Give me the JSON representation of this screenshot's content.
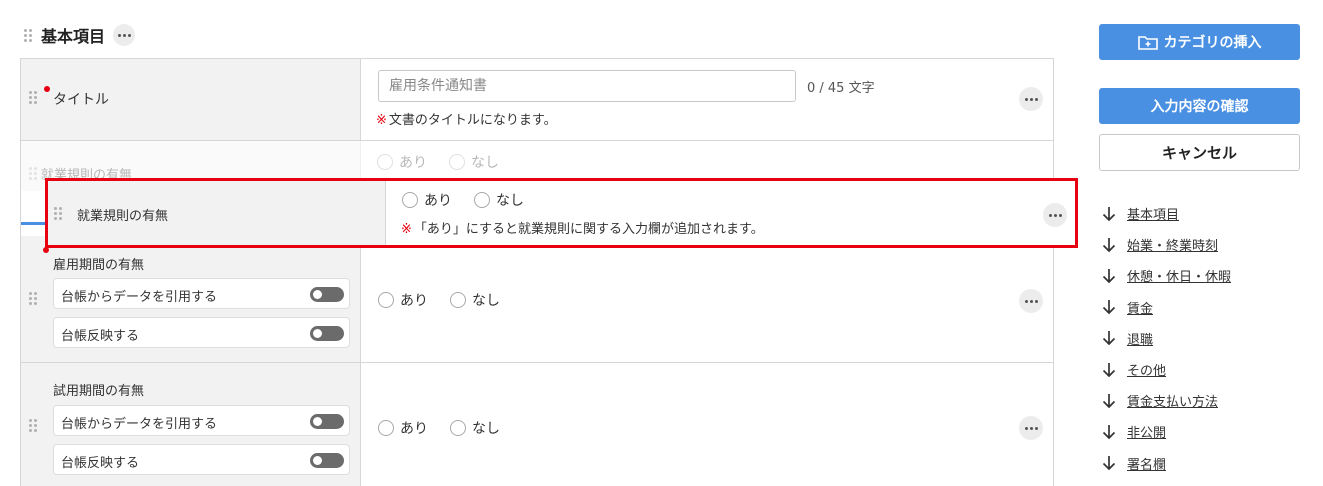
{
  "section": {
    "title": "基本項目"
  },
  "rows": {
    "title": {
      "label": "タイトル",
      "input_placeholder": "雇用条件通知書",
      "input_value": "",
      "counter": "0 / 45 文字",
      "note_mark": "※",
      "note": "文書のタイトルになります。"
    },
    "ghost": {
      "label": "就業規則の有無",
      "opt_yes": "あり",
      "opt_no": "なし"
    },
    "dragging": {
      "label": "就業規則の有無",
      "opt_yes": "あり",
      "opt_no": "なし",
      "note_mark": "※",
      "note": "「あり」にすると就業規則に関する入力欄が追加されます。"
    },
    "employment_period": {
      "label": "雇用期間の有無",
      "toggle_reference": "台帳からデータを引用する",
      "toggle_reflect": "台帳反映する",
      "opt_yes": "あり",
      "opt_no": "なし"
    },
    "trial_period": {
      "label": "試用期間の有無",
      "toggle_reference": "台帳からデータを引用する",
      "toggle_reflect": "台帳反映する",
      "opt_yes": "あり",
      "opt_no": "なし"
    }
  },
  "sidebar": {
    "insert_category_label": "カテゴリの挿入",
    "confirm_label": "入力内容の確認",
    "cancel_label": "キャンセル",
    "toc": [
      "基本項目",
      "始業・終業時刻",
      "休憩・休日・休暇",
      "賃金",
      "退職",
      "その他",
      "賃金支払い方法",
      "非公開",
      "署名欄"
    ]
  },
  "colors": {
    "accent": "#4a90e2",
    "required": "#e60012",
    "highlight": "#e60012"
  }
}
